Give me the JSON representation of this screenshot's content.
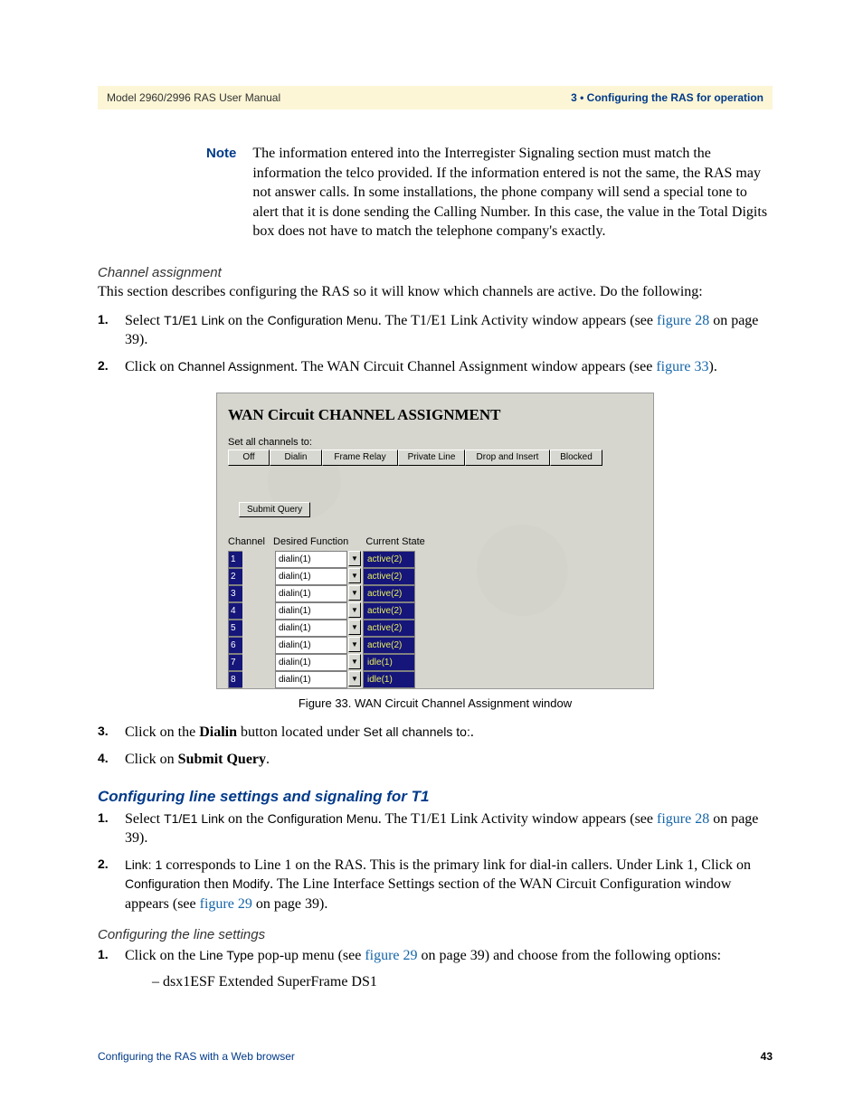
{
  "header": {
    "left": "Model 2960/2996 RAS User Manual",
    "right": "3 • Configuring the RAS for operation"
  },
  "note": {
    "label": "Note",
    "text": "The information entered into the Interregister Signaling section must match the information the telco provided. If the information entered is not the same, the RAS may not answer calls. In some installations, the phone company will send a special tone to alert that it is done sending the Calling Number. In this case, the value in the Total Digits box does not have to match the telephone company's exactly."
  },
  "channel": {
    "heading": "Channel assignment",
    "intro": "This section describes configuring the RAS so it will know which channels are active. Do the following:",
    "step1_num": "1.",
    "step1_a": "Select ",
    "step1_b": "T1/E1 Link",
    "step1_c": " on the ",
    "step1_d": "Configuration Menu",
    "step1_e": ". The T1/E1 Link Activity window appears (see ",
    "step1_link": "figure 28",
    "step1_f": " on page 39).",
    "step2_num": "2.",
    "step2_a": "Click on ",
    "step2_b": "Channel Assignment",
    "step2_c": ". The WAN Circuit Channel Assignment window appears (see ",
    "step2_link": "figure 33",
    "step2_d": ")."
  },
  "figure": {
    "title": "WAN Circuit CHANNEL ASSIGNMENT",
    "set_all": "Set all channels to:",
    "buttons": [
      "Off",
      "Dialin",
      "Frame Relay",
      "Private Line",
      "Drop and Insert",
      "Blocked"
    ],
    "button_widths": [
      44,
      56,
      82,
      72,
      92,
      56
    ],
    "submit": "Submit Query",
    "col1": "Channel",
    "col2": "Desired Function",
    "col3": "Current State",
    "rows": [
      {
        "ch": "1",
        "func": "dialin(1)",
        "state": "active(2)"
      },
      {
        "ch": "2",
        "func": "dialin(1)",
        "state": "active(2)"
      },
      {
        "ch": "3",
        "func": "dialin(1)",
        "state": "active(2)"
      },
      {
        "ch": "4",
        "func": "dialin(1)",
        "state": "active(2)"
      },
      {
        "ch": "5",
        "func": "dialin(1)",
        "state": "active(2)"
      },
      {
        "ch": "6",
        "func": "dialin(1)",
        "state": "active(2)"
      },
      {
        "ch": "7",
        "func": "dialin(1)",
        "state": "idle(1)"
      },
      {
        "ch": "8",
        "func": "dialin(1)",
        "state": "idle(1)"
      }
    ],
    "caption": "Figure 33. WAN Circuit Channel Assignment window"
  },
  "after_fig": {
    "step3_num": "3.",
    "step3_a": "Click on the ",
    "step3_b": "Dialin",
    "step3_c": " button located under ",
    "step3_d": "Set all channels to:",
    "step3_e": ".",
    "step4_num": "4.",
    "step4_a": "Click on ",
    "step4_b": "Submit Query",
    "step4_c": "."
  },
  "t1": {
    "heading": "Configuring line settings and signaling for T1",
    "step1_num": "1.",
    "step1_a": "Select ",
    "step1_b": "T1/E1 Link",
    "step1_c": " on the ",
    "step1_d": "Configuration Menu",
    "step1_e": ". The T1/E1 Link Activity window appears (see ",
    "step1_link": "figure 28",
    "step1_f": " on page 39).",
    "step2_num": "2.",
    "step2_a": "Link: 1",
    "step2_b": " corresponds to Line 1 on the RAS. This is the primary link for dial-in callers. Under Link 1, Click on ",
    "step2_c": "Configuration",
    "step2_d": " then ",
    "step2_e": "Modify",
    "step2_f": ". The Line Interface Settings section of the WAN Circuit Configuration window appears (see ",
    "step2_link": "figure 29",
    "step2_g": " on page 39)."
  },
  "line_settings": {
    "heading": "Configuring the line settings",
    "step1_num": "1.",
    "step1_a": "Click on the ",
    "step1_b": "Line Type",
    "step1_c": " pop-up menu (see ",
    "step1_link": "figure 29",
    "step1_d": " on page 39) and choose from the following options:",
    "dash": "– dsx1ESF Extended SuperFrame DS1"
  },
  "footer": {
    "left": "Configuring the RAS with a Web browser",
    "right": "43"
  }
}
